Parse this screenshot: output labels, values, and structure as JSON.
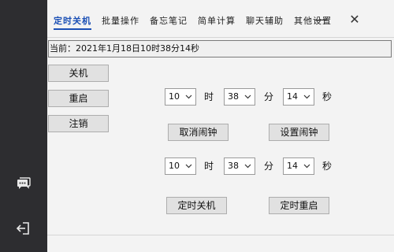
{
  "sidebar": {
    "icons": [
      "chat-icon",
      "logout-icon"
    ]
  },
  "tabs": [
    {
      "label": "定时关机",
      "active": true
    },
    {
      "label": "批量操作"
    },
    {
      "label": "备忘笔记"
    },
    {
      "label": "简单计算"
    },
    {
      "label": "聊天辅助"
    },
    {
      "label": "其他设置"
    }
  ],
  "window": {
    "minimize_label": "—",
    "close_label": "✕"
  },
  "status": {
    "text": "当前：2021年1月18日10时38分14秒"
  },
  "side_buttons": {
    "shutdown": "关机",
    "restart": "重启",
    "logoff": "注销"
  },
  "alarm": {
    "hour": "10",
    "minute": "38",
    "second": "14",
    "hour_unit": "时",
    "minute_unit": "分",
    "second_unit": "秒",
    "cancel_label": "取消闹钟",
    "set_label": "设置闹钟"
  },
  "timer": {
    "hour": "10",
    "minute": "38",
    "second": "14",
    "hour_unit": "时",
    "minute_unit": "分",
    "second_unit": "秒",
    "shutdown_label": "定时关机",
    "restart_label": "定时重启"
  },
  "colors": {
    "sidebar_bg": "#2d2d30",
    "active_tab": "#1a4fb5"
  }
}
